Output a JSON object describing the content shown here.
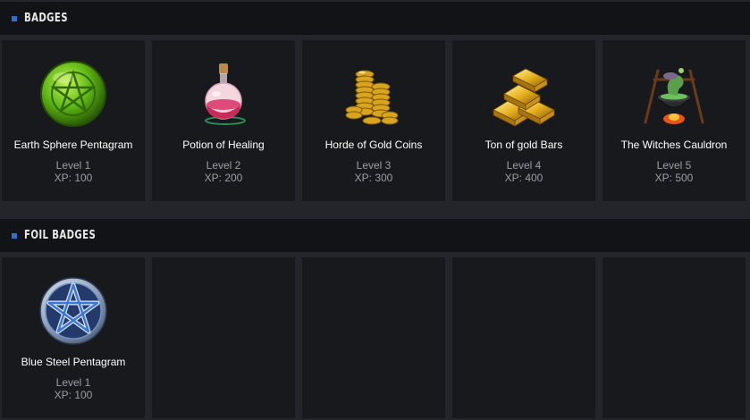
{
  "sections": {
    "badges": {
      "title": "BADGES",
      "items": [
        {
          "name": "Earth Sphere Pentagram",
          "level": "Level 1",
          "xp": "XP: 100",
          "icon": "earth-sphere-pentagram-icon"
        },
        {
          "name": "Potion of Healing",
          "level": "Level 2",
          "xp": "XP: 200",
          "icon": "potion-icon"
        },
        {
          "name": "Horde of Gold Coins",
          "level": "Level 3",
          "xp": "XP: 300",
          "icon": "gold-coins-icon"
        },
        {
          "name": "Ton of gold Bars",
          "level": "Level 4",
          "xp": "XP: 400",
          "icon": "gold-bars-icon"
        },
        {
          "name": "The Witches Cauldron",
          "level": "Level 5",
          "xp": "XP: 500",
          "icon": "cauldron-icon"
        }
      ]
    },
    "foil": {
      "title": "FOIL BADGES",
      "items": [
        {
          "name": "Blue Steel Pentagram",
          "level": "Level 1",
          "xp": "XP: 100",
          "icon": "blue-steel-pentagram-icon"
        }
      ]
    }
  },
  "colors": {
    "background": "#23252a",
    "header": "#121316",
    "card": "#18191d",
    "accent": "#2f6fd1",
    "muted_text": "#9b9da3"
  }
}
